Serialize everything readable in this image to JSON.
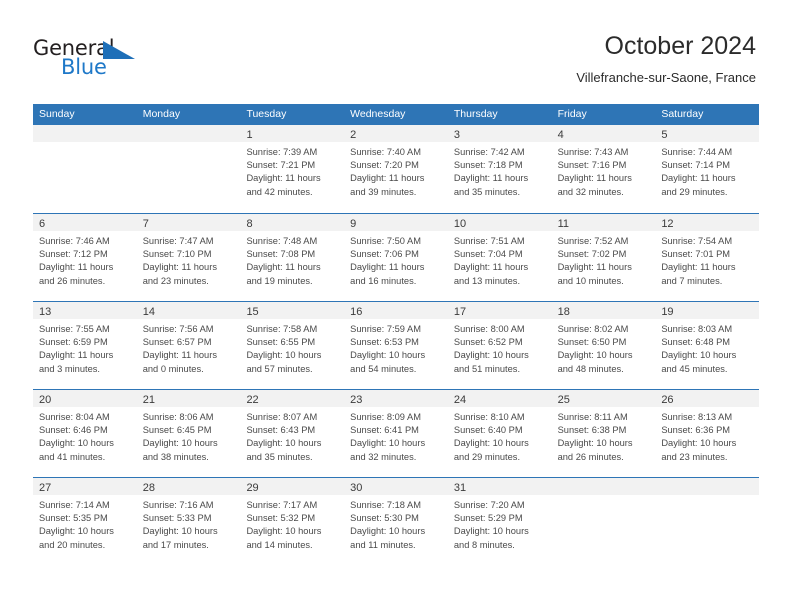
{
  "brand": {
    "name_top": "General",
    "name_bottom": "Blue",
    "triangle_color": "#1e6fb8",
    "blue_text_color": "#1e78c8"
  },
  "header": {
    "title": "October 2024",
    "subtitle": "Villefranche-sur-Saone, France"
  },
  "theme": {
    "header_blue": "#2e75b6",
    "date_band_gray": "#f2f2f2",
    "text_color": "#4a4a4a"
  },
  "calendar": {
    "weekdays": [
      "Sunday",
      "Monday",
      "Tuesday",
      "Wednesday",
      "Thursday",
      "Friday",
      "Saturday"
    ],
    "weeks": [
      [
        {
          "day": "",
          "lines": []
        },
        {
          "day": "",
          "lines": []
        },
        {
          "day": "1",
          "lines": [
            "Sunrise: 7:39 AM",
            "Sunset: 7:21 PM",
            "Daylight: 11 hours",
            "and 42 minutes."
          ]
        },
        {
          "day": "2",
          "lines": [
            "Sunrise: 7:40 AM",
            "Sunset: 7:20 PM",
            "Daylight: 11 hours",
            "and 39 minutes."
          ]
        },
        {
          "day": "3",
          "lines": [
            "Sunrise: 7:42 AM",
            "Sunset: 7:18 PM",
            "Daylight: 11 hours",
            "and 35 minutes."
          ]
        },
        {
          "day": "4",
          "lines": [
            "Sunrise: 7:43 AM",
            "Sunset: 7:16 PM",
            "Daylight: 11 hours",
            "and 32 minutes."
          ]
        },
        {
          "day": "5",
          "lines": [
            "Sunrise: 7:44 AM",
            "Sunset: 7:14 PM",
            "Daylight: 11 hours",
            "and 29 minutes."
          ]
        }
      ],
      [
        {
          "day": "6",
          "lines": [
            "Sunrise: 7:46 AM",
            "Sunset: 7:12 PM",
            "Daylight: 11 hours",
            "and 26 minutes."
          ]
        },
        {
          "day": "7",
          "lines": [
            "Sunrise: 7:47 AM",
            "Sunset: 7:10 PM",
            "Daylight: 11 hours",
            "and 23 minutes."
          ]
        },
        {
          "day": "8",
          "lines": [
            "Sunrise: 7:48 AM",
            "Sunset: 7:08 PM",
            "Daylight: 11 hours",
            "and 19 minutes."
          ]
        },
        {
          "day": "9",
          "lines": [
            "Sunrise: 7:50 AM",
            "Sunset: 7:06 PM",
            "Daylight: 11 hours",
            "and 16 minutes."
          ]
        },
        {
          "day": "10",
          "lines": [
            "Sunrise: 7:51 AM",
            "Sunset: 7:04 PM",
            "Daylight: 11 hours",
            "and 13 minutes."
          ]
        },
        {
          "day": "11",
          "lines": [
            "Sunrise: 7:52 AM",
            "Sunset: 7:02 PM",
            "Daylight: 11 hours",
            "and 10 minutes."
          ]
        },
        {
          "day": "12",
          "lines": [
            "Sunrise: 7:54 AM",
            "Sunset: 7:01 PM",
            "Daylight: 11 hours",
            "and 7 minutes."
          ]
        }
      ],
      [
        {
          "day": "13",
          "lines": [
            "Sunrise: 7:55 AM",
            "Sunset: 6:59 PM",
            "Daylight: 11 hours",
            "and 3 minutes."
          ]
        },
        {
          "day": "14",
          "lines": [
            "Sunrise: 7:56 AM",
            "Sunset: 6:57 PM",
            "Daylight: 11 hours",
            "and 0 minutes."
          ]
        },
        {
          "day": "15",
          "lines": [
            "Sunrise: 7:58 AM",
            "Sunset: 6:55 PM",
            "Daylight: 10 hours",
            "and 57 minutes."
          ]
        },
        {
          "day": "16",
          "lines": [
            "Sunrise: 7:59 AM",
            "Sunset: 6:53 PM",
            "Daylight: 10 hours",
            "and 54 minutes."
          ]
        },
        {
          "day": "17",
          "lines": [
            "Sunrise: 8:00 AM",
            "Sunset: 6:52 PM",
            "Daylight: 10 hours",
            "and 51 minutes."
          ]
        },
        {
          "day": "18",
          "lines": [
            "Sunrise: 8:02 AM",
            "Sunset: 6:50 PM",
            "Daylight: 10 hours",
            "and 48 minutes."
          ]
        },
        {
          "day": "19",
          "lines": [
            "Sunrise: 8:03 AM",
            "Sunset: 6:48 PM",
            "Daylight: 10 hours",
            "and 45 minutes."
          ]
        }
      ],
      [
        {
          "day": "20",
          "lines": [
            "Sunrise: 8:04 AM",
            "Sunset: 6:46 PM",
            "Daylight: 10 hours",
            "and 41 minutes."
          ]
        },
        {
          "day": "21",
          "lines": [
            "Sunrise: 8:06 AM",
            "Sunset: 6:45 PM",
            "Daylight: 10 hours",
            "and 38 minutes."
          ]
        },
        {
          "day": "22",
          "lines": [
            "Sunrise: 8:07 AM",
            "Sunset: 6:43 PM",
            "Daylight: 10 hours",
            "and 35 minutes."
          ]
        },
        {
          "day": "23",
          "lines": [
            "Sunrise: 8:09 AM",
            "Sunset: 6:41 PM",
            "Daylight: 10 hours",
            "and 32 minutes."
          ]
        },
        {
          "day": "24",
          "lines": [
            "Sunrise: 8:10 AM",
            "Sunset: 6:40 PM",
            "Daylight: 10 hours",
            "and 29 minutes."
          ]
        },
        {
          "day": "25",
          "lines": [
            "Sunrise: 8:11 AM",
            "Sunset: 6:38 PM",
            "Daylight: 10 hours",
            "and 26 minutes."
          ]
        },
        {
          "day": "26",
          "lines": [
            "Sunrise: 8:13 AM",
            "Sunset: 6:36 PM",
            "Daylight: 10 hours",
            "and 23 minutes."
          ]
        }
      ],
      [
        {
          "day": "27",
          "lines": [
            "Sunrise: 7:14 AM",
            "Sunset: 5:35 PM",
            "Daylight: 10 hours",
            "and 20 minutes."
          ]
        },
        {
          "day": "28",
          "lines": [
            "Sunrise: 7:16 AM",
            "Sunset: 5:33 PM",
            "Daylight: 10 hours",
            "and 17 minutes."
          ]
        },
        {
          "day": "29",
          "lines": [
            "Sunrise: 7:17 AM",
            "Sunset: 5:32 PM",
            "Daylight: 10 hours",
            "and 14 minutes."
          ]
        },
        {
          "day": "30",
          "lines": [
            "Sunrise: 7:18 AM",
            "Sunset: 5:30 PM",
            "Daylight: 10 hours",
            "and 11 minutes."
          ]
        },
        {
          "day": "31",
          "lines": [
            "Sunrise: 7:20 AM",
            "Sunset: 5:29 PM",
            "Daylight: 10 hours",
            "and 8 minutes."
          ]
        },
        {
          "day": "",
          "lines": []
        },
        {
          "day": "",
          "lines": []
        }
      ]
    ]
  }
}
